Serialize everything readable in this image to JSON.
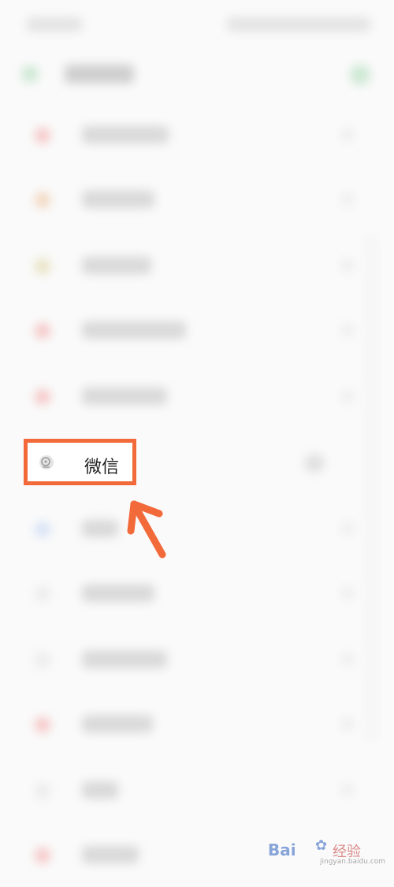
{
  "highlighted_item": {
    "icon": "wechat-icon",
    "label": "微信"
  },
  "annotation": {
    "box_color": "#f2693a",
    "arrow_color": "#f2693a"
  },
  "watermark": {
    "text": "Bai",
    "text_cn": "经验",
    "url": "jingyan.baidu.com"
  }
}
